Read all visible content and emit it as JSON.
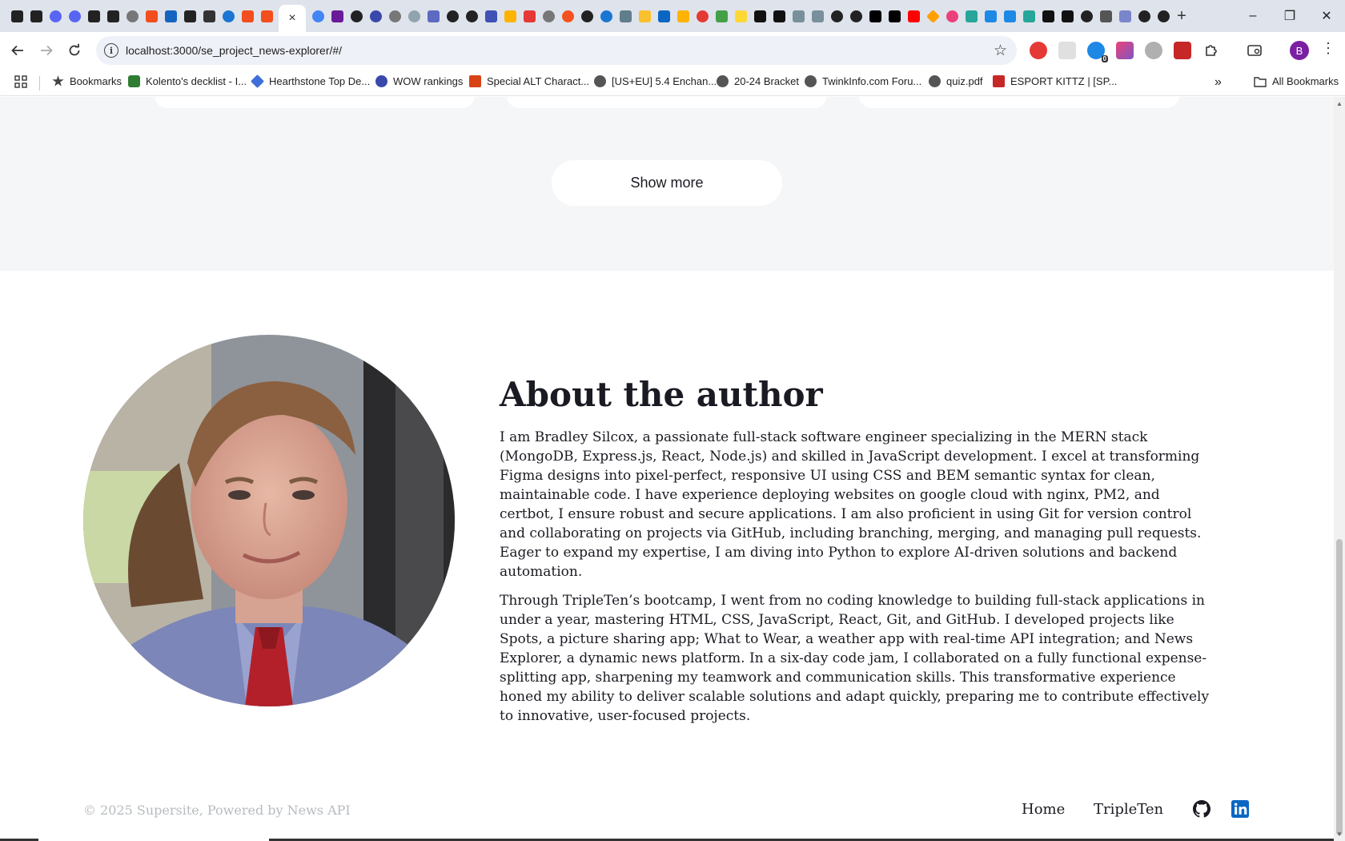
{
  "browser": {
    "active_tab_close": "×",
    "new_tab": "+",
    "window_controls": {
      "minimize": "–",
      "restore": "❐",
      "close": "✕"
    },
    "url": "localhost:3000/se_project_news-explorer/#/",
    "extension_badge": "0",
    "profile_initial": "B",
    "bookmarks": [
      {
        "label": "Bookmarks",
        "icon": "star-icon",
        "color": "#444444"
      },
      {
        "label": "Kolento's decklist - I...",
        "icon": "kolento-icon",
        "color": "#2e7d32"
      },
      {
        "label": "Hearthstone Top De...",
        "icon": "hearthstone-icon",
        "color": "#3f6fd8"
      },
      {
        "label": "WOW rankings",
        "icon": "wow-icon",
        "color": "#3949ab"
      },
      {
        "label": "Special ALT Charact...",
        "icon": "alt-icon",
        "color": "#d84315"
      },
      {
        "label": "[US+EU] 5.4 Enchan...",
        "icon": "globe-icon",
        "color": "#555555"
      },
      {
        "label": "20-24 Bracket",
        "icon": "globe-icon",
        "color": "#555555"
      },
      {
        "label": "TwinkInfo.com Foru...",
        "icon": "globe-icon",
        "color": "#555555"
      },
      {
        "label": "quiz.pdf",
        "icon": "globe-icon",
        "color": "#555555"
      },
      {
        "label": "ESPORT KITTZ | [SP...",
        "icon": "esport-icon",
        "color": "#c62828"
      }
    ],
    "all_bookmarks": "All Bookmarks",
    "overflow": "»"
  },
  "page": {
    "show_more_label": "Show more",
    "about": {
      "title": "About the author",
      "paragraph_1": "I am Bradley Silcox, a passionate full-stack software engineer specializing in the MERN stack (MongoDB, Express.js, React, Node.js) and skilled in JavaScript development. I excel at transforming Figma designs into pixel-perfect, responsive UI using CSS and BEM semantic syntax for clean, maintainable code. I have experience deploying websites on google cloud with nginx, PM2, and certbot, I ensure robust and secure applications. I am also proficient in using Git for version control and collaborating on projects via GitHub, including branching, merging, and managing pull requests. Eager to expand my expertise, I am diving into Python to explore AI-driven solutions and backend automation.",
      "paragraph_2": "Through TripleTen’s bootcamp, I went from no coding knowledge to building full-stack applications in under a year, mastering HTML, CSS, JavaScript, React, Git, and GitHub. I developed projects like Spots, a picture sharing app; What to Wear, a weather app with real-time API integration; and News Explorer, a dynamic news platform. In a six-day code jam, I collaborated on a fully functional expense-splitting app, sharpening my teamwork and communication skills. This transformative experience honed my ability to deliver scalable solutions and adapt quickly, preparing me to contribute effectively to innovative, user-focused projects."
    },
    "footer": {
      "copyright": "© 2025 Supersite, Powered by News API",
      "links": [
        "Home",
        "TripleTen"
      ],
      "github_icon": "github-icon",
      "linkedin_icon": "linkedin-icon",
      "linkedin_color": "#0a66c2"
    }
  }
}
